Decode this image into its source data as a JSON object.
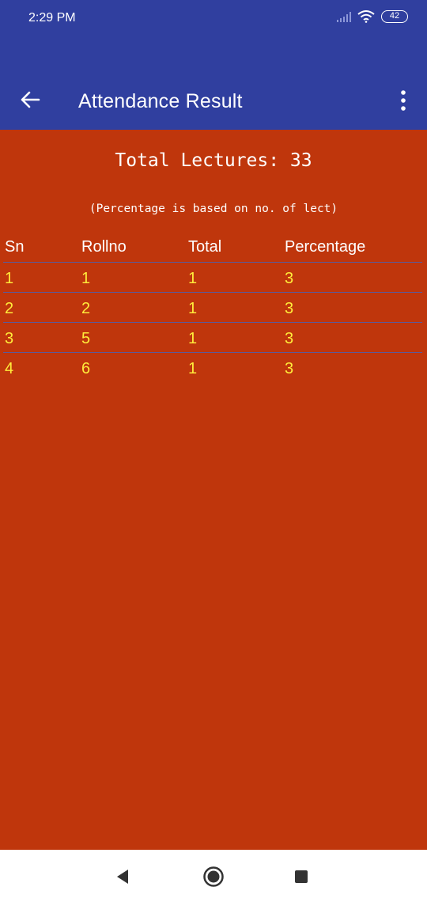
{
  "status_bar": {
    "time": "2:29 PM",
    "battery": "42",
    "icons": [
      "signal-icon",
      "wifi-icon",
      "battery-icon"
    ]
  },
  "app_bar": {
    "title": "Attendance Result",
    "icons": [
      "back-arrow-icon",
      "more-vert-icon"
    ]
  },
  "summary": {
    "total_lectures": "Total Lectures: 33",
    "note": "(Percentage is based on no. of lect)"
  },
  "table": {
    "headers": [
      "Sn",
      "Rollno",
      "Total",
      "Percentage"
    ],
    "rows": [
      [
        "1",
        "1",
        "1",
        "3"
      ],
      [
        "2",
        "2",
        "1",
        "3"
      ],
      [
        "3",
        "5",
        "1",
        "3"
      ],
      [
        "4",
        "6",
        "1",
        "3"
      ]
    ]
  },
  "nav_bar": {
    "icons": [
      "nav-back-icon",
      "nav-home-icon",
      "nav-recents-icon"
    ]
  },
  "colors": {
    "app_bar": "#303f9f",
    "background": "#bf360c",
    "row_text": "#ffeb3b",
    "header_text": "#ffffff"
  }
}
